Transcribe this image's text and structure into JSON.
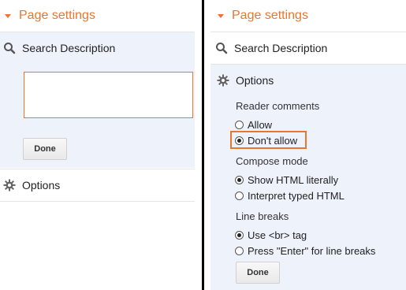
{
  "left": {
    "header_title": "Page settings",
    "search_description_label": "Search Description",
    "textarea_value": "",
    "done_label": "Done",
    "options_label": "Options"
  },
  "right": {
    "header_title": "Page settings",
    "search_description_label": "Search Description",
    "options_label": "Options",
    "reader_comments": {
      "label": "Reader comments",
      "allow": "Allow",
      "dont_allow": "Don't allow"
    },
    "compose_mode": {
      "label": "Compose mode",
      "show_html": "Show HTML literally",
      "interpret_html": "Interpret typed HTML"
    },
    "line_breaks": {
      "label": "Line breaks",
      "use_br": "Use <br> tag",
      "press_enter": "Press \"Enter\" for line breaks"
    },
    "done_label": "Done"
  },
  "colors": {
    "accent": "#e8762d",
    "panel_shade": "#edf2fb"
  }
}
